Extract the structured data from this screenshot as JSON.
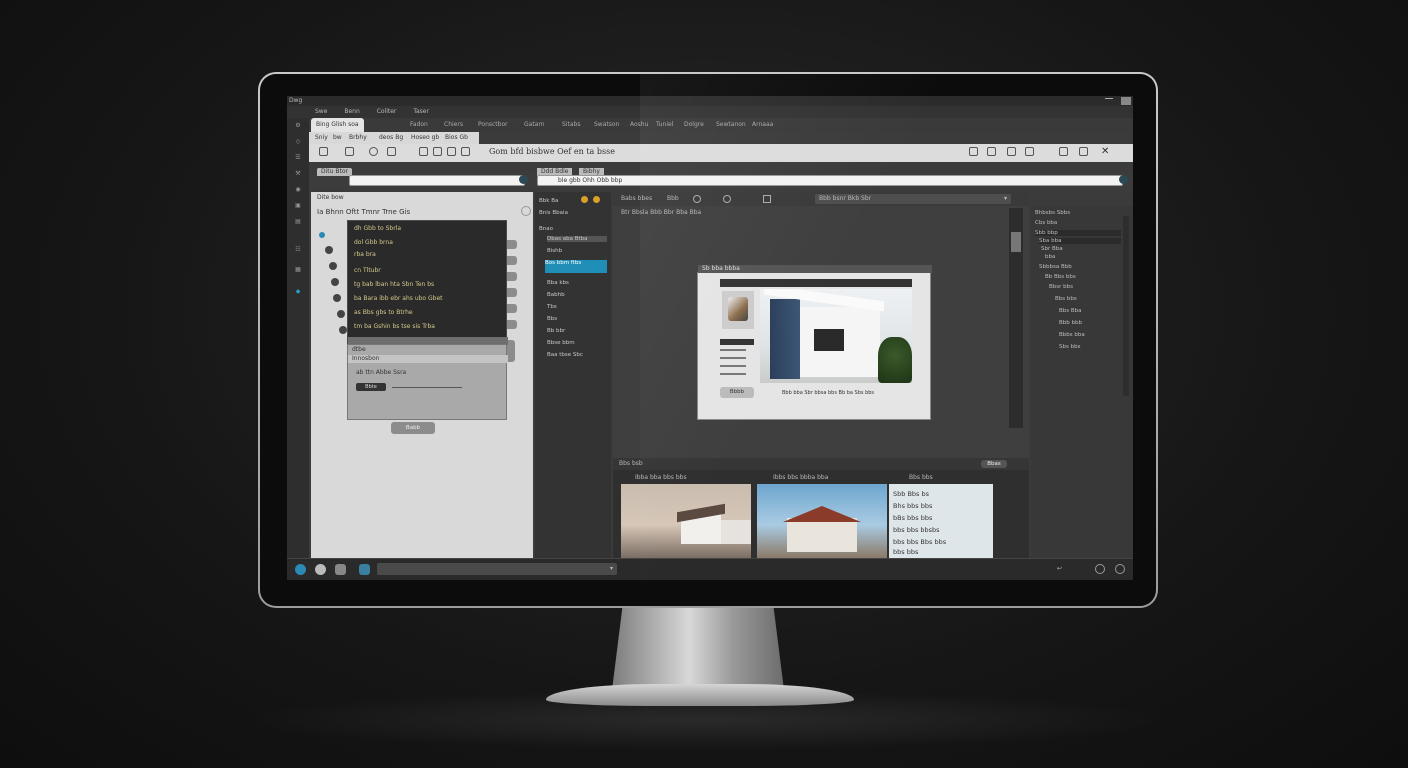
{
  "window": {
    "title": "Dwg"
  },
  "menu": [
    "Swe",
    "Benn",
    "Coliter",
    "Taser",
    "Fadon",
    "Chiers",
    "Ponsctbor",
    "Gatarn",
    "Sitabs",
    "Swatson",
    "Aoshu",
    "Tuniel",
    "Dolgre",
    "Sewtanon",
    "Arnaaa"
  ],
  "tabs": {
    "primary": {
      "label": "Bing Glish soa"
    },
    "secondary": [
      "Sniy",
      "bw",
      "Brbhy",
      "deos Bg",
      "Hoseo gb",
      "Bios Gb"
    ]
  },
  "toolbar": {
    "title": "Gom bfd bisbwe Oef en ta bsse"
  },
  "left_panel": {
    "title": "Ditu Btor",
    "field_label": "Dite bow",
    "toolbar_label": "Ia Bhnn  Oftt Tmnr  Trne Gis",
    "code_lines": [
      "dh Gbb to Sbrla",
      "dol Gbb brna",
      "rba bra",
      "cn Tltubr",
      "tg bab lban hta Sbn Ten bs",
      "ba Bara ibb ebr ahs ubo Gbet",
      "as Bbs gbs to Btrhe",
      "tm ba Gshin bs tse sis Trba"
    ],
    "sub_header": "dtbe",
    "sub_row": "Innosbon",
    "sub_text": "ab ttn Abbe Ssra",
    "sub_button": "Bbte",
    "bottom_button": "Babb"
  },
  "mid_panel": {
    "tabs": [
      "Ddd Bdle",
      "Bibhy"
    ],
    "header": "Bbk Ba",
    "sub": "Bnis   Bbaia",
    "items": [
      "Bnao",
      "Dbas aba Btba",
      "Bishb",
      "Bos bbm ftbs",
      "Bba kbs",
      "Babhb",
      "Tbs",
      "Bbs",
      "Bb bbr",
      "Bbse bbm",
      "Baa tbse Sbc"
    ],
    "selected_index": 3
  },
  "address": {
    "value": "ble gbb  Ohh Obb  bbp"
  },
  "viewport": {
    "toolbar": [
      "Babs bbes",
      "Bbb",
      "Bbb bsnr Bkb Sbr"
    ],
    "breadcrumb": "Btr  Bbsla  Bbb Bbr  Bba  Bba",
    "doc_title": "Sb bba bbba",
    "doc_caption": "Bbb bba Sbr bbsa bbs Bb ba Sbs bbs",
    "doc_button": "Bbbb"
  },
  "right_panel": {
    "title": "Bhbsbs Sbbs",
    "items": [
      "Cbs bba",
      "Sbb bbp",
      "Sba bba",
      "Sbr Bba",
      "bba",
      "Sbbbsa Bbb",
      "Bb Bbs bbs",
      "Bbsr bbs",
      "Bbs bbs",
      "Bbs Bba",
      "Bbb bbb",
      "Bbbs bba",
      "Sbs bbs"
    ]
  },
  "filmstrip": {
    "header": "Bbs bsb",
    "labels": [
      "Ibba bba bbs bbs",
      "Ibbs bbs bbba bba",
      "Bbs bbs"
    ],
    "text_lines": [
      "Sbb Bbs bs",
      "Bhs bbs bbs",
      "bBs bbs bbs",
      "bbs bbs bbsbs",
      "bbs bbs Bbs bbs",
      "bbs bbs"
    ],
    "button": "Bbas"
  },
  "colors": {
    "accent": "#1f8fb8",
    "panel_light": "#d9d9d9",
    "panel_dark": "#333333"
  }
}
